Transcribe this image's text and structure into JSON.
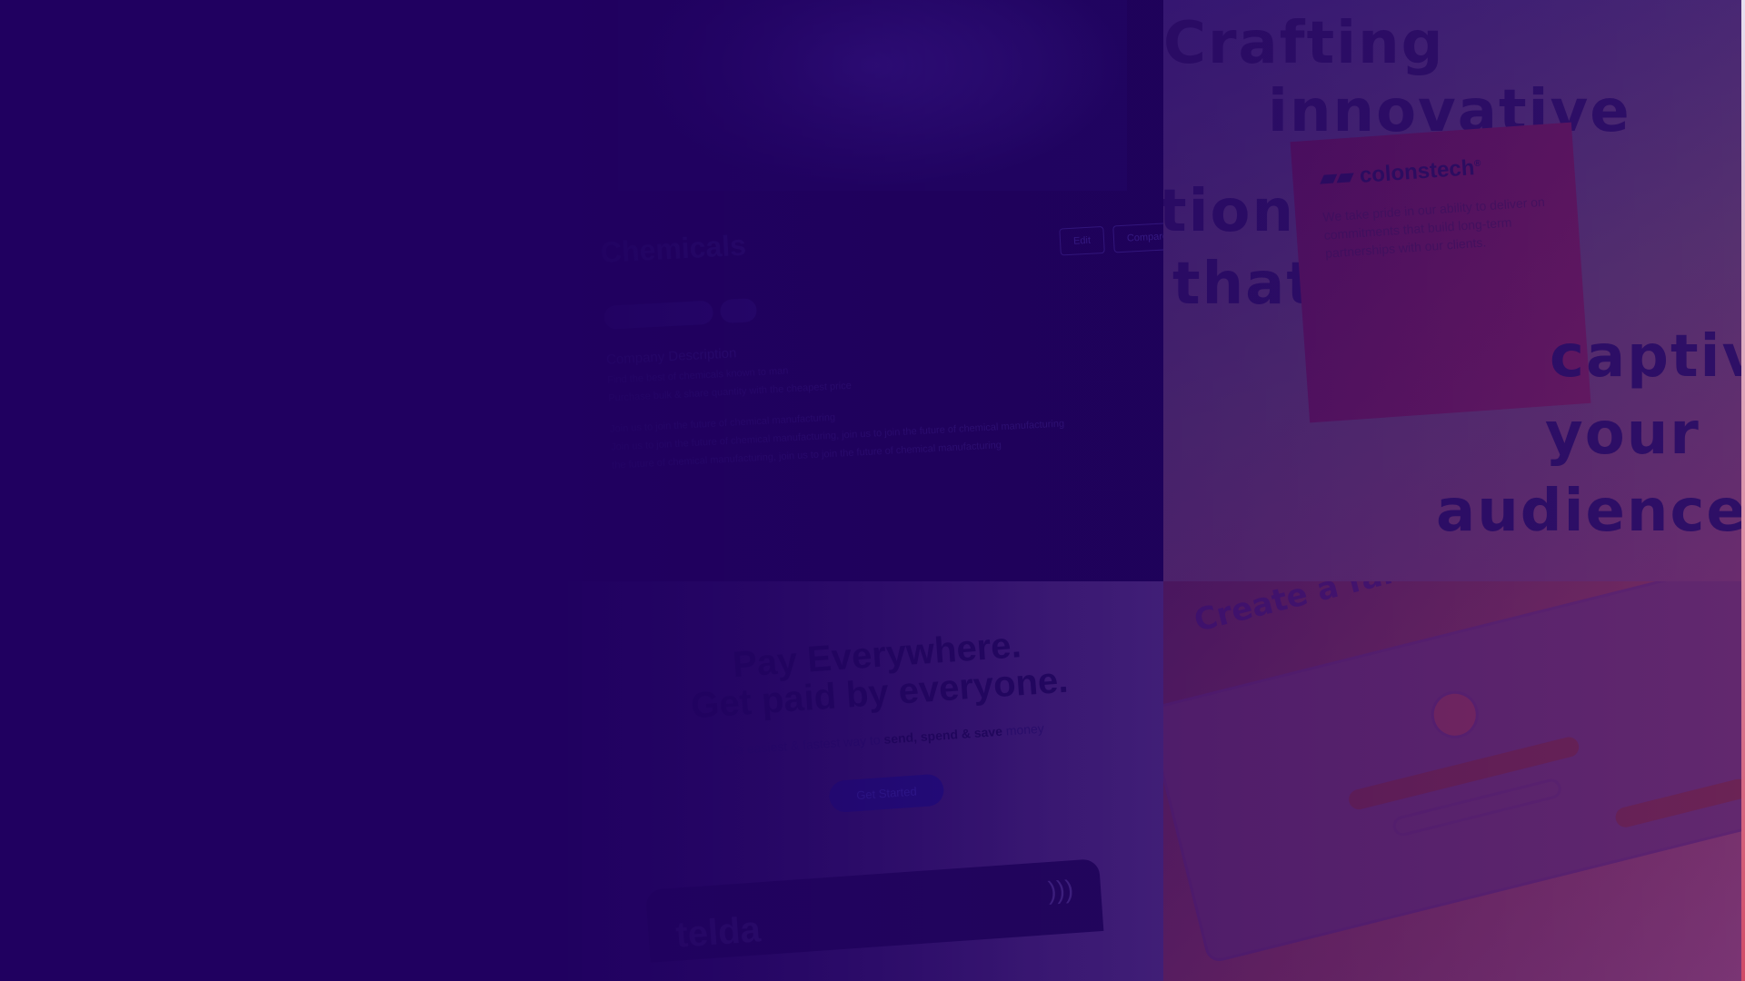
{
  "chemicals_tile": {
    "title": "Chemicals",
    "buttons": [
      "Edit",
      "Compare"
    ],
    "section_heading": "Company Description",
    "lines": [
      "Find the best of chemicals known to man",
      "Purchase bulk & share quantity with the cheapest price",
      "Join us to join the future of chemical manufacturing",
      "Join us to join the future of chemical manufacturing, join us to join the future of chemical manufacturing",
      "the future of chemical manufacturing, join us to join the future of chemical manufacturing"
    ]
  },
  "pay_tile": {
    "headline_1": "Pay Everywhere.",
    "headline_2": "Get paid by everyone.",
    "sub_prefix": "The easiest & fastest way to",
    "sub_bold": "send, spend & save",
    "sub_suffix": "money",
    "cta": "Get Started",
    "card_brand": "telda",
    "contactless_glyph": ")))"
  },
  "crafting_tile": {
    "words": [
      "Crafting",
      "innovative",
      "tions",
      "that",
      "captiv",
      "your",
      "audience"
    ],
    "note_brand": "colonstech",
    "note_brand_mark": "®",
    "note_text": "We take pride in our ability to deliver on commitments that build long-term partnerships with our clients."
  },
  "fan_tile": {
    "headline": "Create a fan blaug"
  },
  "colors": {
    "overlay": "#200060",
    "accent_pink": "#d04a66"
  }
}
